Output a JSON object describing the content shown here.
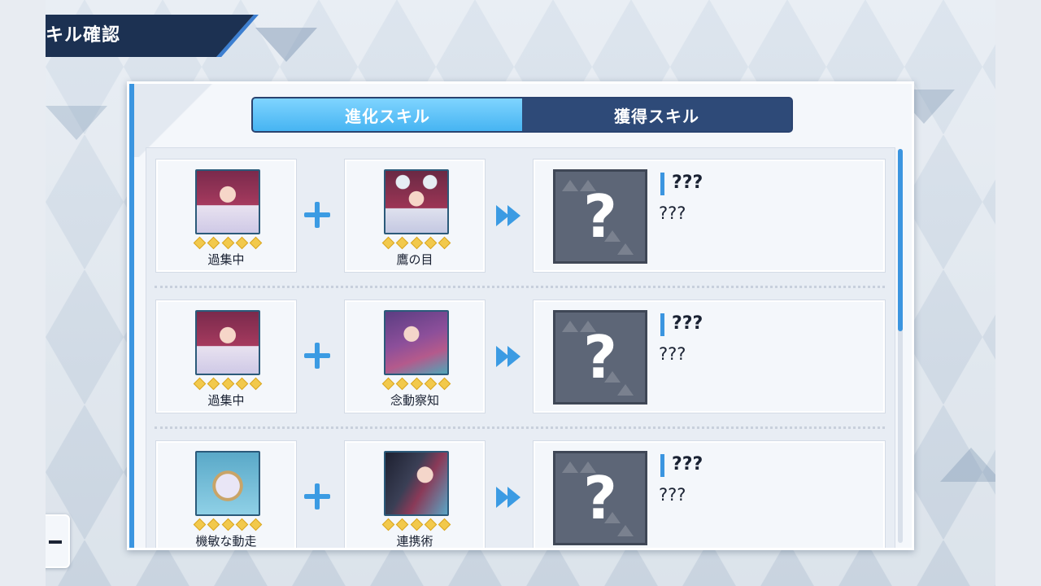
{
  "header": {
    "title": "キル確認"
  },
  "tabs": [
    {
      "label": "進化スキル",
      "active": true
    },
    {
      "label": "獲得スキル",
      "active": false
    }
  ],
  "colors": {
    "accent": "#3b95e0",
    "tab_active": "#46b4f2",
    "tab_inactive": "#2e4a78",
    "title_banner": "#1c3152",
    "star": "#f2c94c"
  },
  "icons": {
    "combine": "plus-icon",
    "result": "double-arrow-icon",
    "unknown": "question-mark-icon",
    "rarity": "star-icon"
  },
  "rows": [
    {
      "skill_a": {
        "name": "過集中",
        "icon": "girl-portrait-icon",
        "stars": 5
      },
      "skill_b": {
        "name": "鷹の目",
        "icon": "girl-eyes-portrait-icon",
        "stars": 5
      },
      "result": {
        "icon_text": "?",
        "title": "???",
        "description": "???"
      }
    },
    {
      "skill_a": {
        "name": "過集中",
        "icon": "girl-portrait-icon",
        "stars": 5
      },
      "skill_b": {
        "name": "念動察知",
        "icon": "girl-purple-portrait-icon",
        "stars": 5
      },
      "result": {
        "icon_text": "?",
        "title": "???",
        "description": "???"
      }
    },
    {
      "skill_a": {
        "name": "機敏な動走",
        "icon": "pocket-watch-icon",
        "stars": 5
      },
      "skill_b": {
        "name": "連携術",
        "icon": "girl-dark-portrait-icon",
        "stars": 5
      },
      "result": {
        "icon_text": "?",
        "title": "???",
        "description": "???"
      }
    }
  ],
  "scroll": {
    "position": 0.0,
    "visible_fraction": 0.46
  }
}
